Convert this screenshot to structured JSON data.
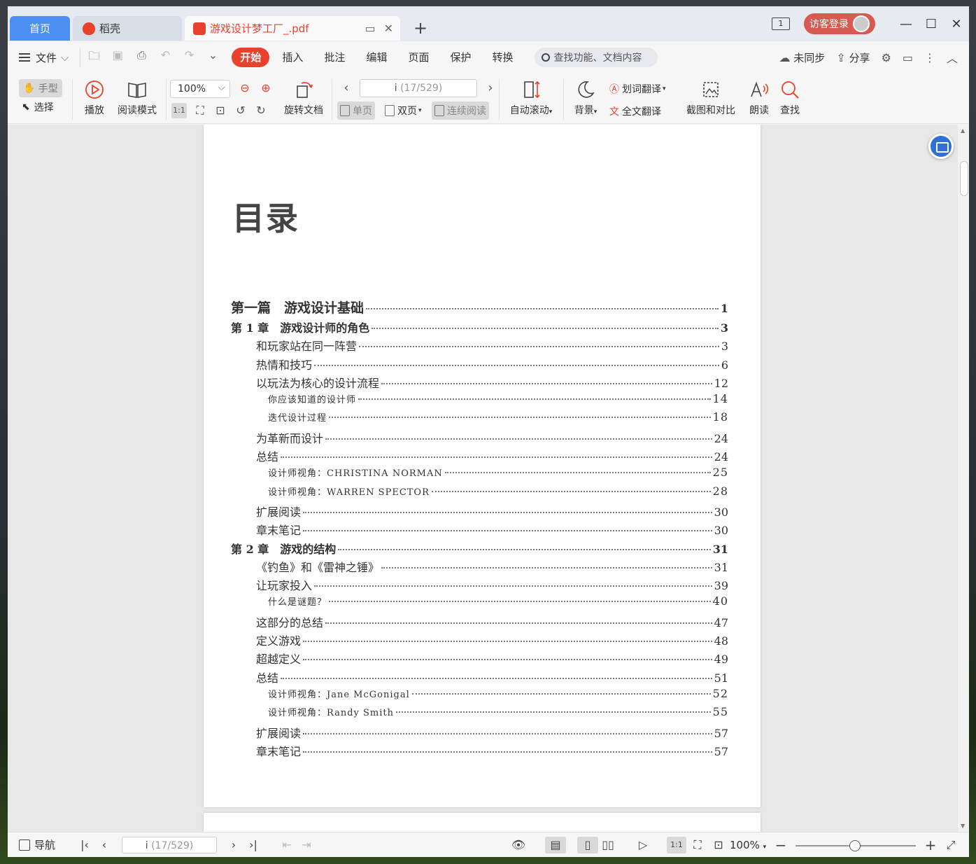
{
  "tabs": {
    "home": "首页",
    "daoke": "稻壳",
    "doc": "游戏设计梦工厂_.pdf"
  },
  "titlebar": {
    "page_count_icon": "1",
    "login": "访客登录"
  },
  "menu": {
    "file": "文件",
    "tabs": [
      "开始",
      "插入",
      "批注",
      "编辑",
      "页面",
      "保护",
      "转换"
    ],
    "search_placeholder": "查找功能、文档内容",
    "sync": "未同步",
    "share": "分享"
  },
  "ribbon": {
    "hand": "手型",
    "select": "选择",
    "play": "播放",
    "read_mode": "阅读模式",
    "zoom": "100%",
    "rotate": "旋转文档",
    "page_current": "i",
    "page_total": "(17/529)",
    "single": "单页",
    "double": "双页",
    "continuous": "连续阅读",
    "auto_scroll": "自动滚动",
    "background": "背景",
    "word_translate": "划词翻译",
    "full_translate": "全文翻译",
    "screenshot_compare": "截图和对比",
    "read_aloud": "朗读",
    "find": "查找"
  },
  "document": {
    "title": "目录",
    "toc": [
      {
        "level": 0,
        "text": "第一篇　游戏设计基础",
        "page": "1"
      },
      {
        "level": 1,
        "text": "第 1 章　游戏设计师的角色",
        "page": "3"
      },
      {
        "level": 2,
        "text": "和玩家站在同一阵营",
        "page": "3"
      },
      {
        "level": 2,
        "text": "热情和技巧",
        "page": "6"
      },
      {
        "level": 2,
        "text": "以玩法为核心的设计流程",
        "page": "12"
      },
      {
        "level": 3,
        "text": "你应该知道的设计师",
        "page": "14"
      },
      {
        "level": 3,
        "text": "迭代设计过程",
        "page": "18"
      },
      {
        "level": 2,
        "text": "为革新而设计",
        "page": "24"
      },
      {
        "level": 2,
        "text": "总结",
        "page": "24"
      },
      {
        "level": 3,
        "text": "设计师视角：CHRISTINA NORMAN",
        "page": "25"
      },
      {
        "level": 3,
        "text": "设计师视角：WARREN SPECTOR",
        "page": "28"
      },
      {
        "level": 2,
        "text": "扩展阅读",
        "page": "30"
      },
      {
        "level": 2,
        "text": "章末笔记",
        "page": "30"
      },
      {
        "level": 1,
        "text": "第 2 章　游戏的结构",
        "page": "31"
      },
      {
        "level": 2,
        "text": "《钓鱼》和《雷神之锤》",
        "page": "31"
      },
      {
        "level": 2,
        "text": "让玩家投入",
        "page": "39"
      },
      {
        "level": 3,
        "text": "什么是谜题？",
        "page": "40"
      },
      {
        "level": 2,
        "text": "这部分的总结",
        "page": "47"
      },
      {
        "level": 2,
        "text": "定义游戏",
        "page": "48"
      },
      {
        "level": 2,
        "text": "超越定义",
        "page": "49"
      },
      {
        "level": 2,
        "text": "总结",
        "page": "51"
      },
      {
        "level": 3,
        "text": "设计师视角：Jane McGonigal",
        "page": "52"
      },
      {
        "level": 3,
        "text": "设计师视角：Randy Smith",
        "page": "55"
      },
      {
        "level": 2,
        "text": "扩展阅读",
        "page": "57"
      },
      {
        "level": 2,
        "text": "章末笔记",
        "page": "57"
      }
    ]
  },
  "statusbar": {
    "nav": "导航",
    "page_current": "i",
    "page_total": "(17/529)",
    "zoom": "100%"
  },
  "colors": {
    "accent": "#e8412c",
    "home_tab": "#4d8ef5",
    "login": "#d65a4f"
  }
}
